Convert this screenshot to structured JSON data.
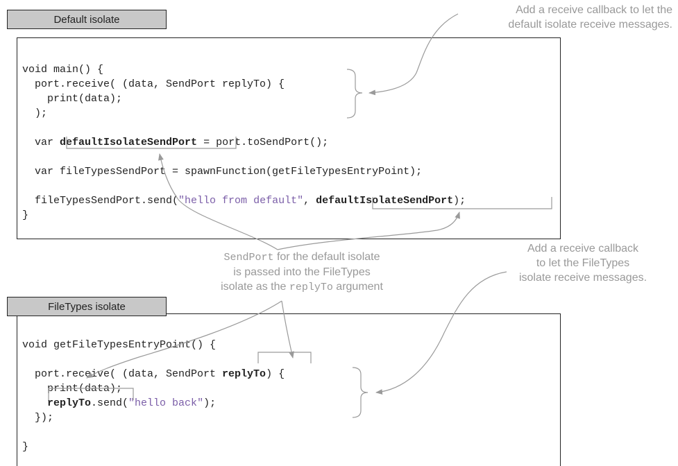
{
  "default_box": {
    "title": "Default isolate",
    "lines": [
      [
        "void main() {"
      ],
      [
        "  port.receive( (data, SendPort replyTo) {"
      ],
      [
        "    print(data);"
      ],
      [
        "  );"
      ],
      [
        ""
      ],
      [
        "  var ",
        {
          "b": "defaultIsolateSendPort"
        },
        " = port.toSendPort();"
      ],
      [
        ""
      ],
      [
        "  var fileTypesSendPort = spawnFunction(getFileTypesEntryPoint);"
      ],
      [
        ""
      ],
      [
        "  fileTypesSendPort.send(",
        {
          "s": "\"hello from default\""
        },
        ", ",
        {
          "b": "defaultIsolateSendPort"
        },
        ");"
      ],
      [
        "}"
      ]
    ]
  },
  "filetypes_box": {
    "title": "FileTypes isolate",
    "lines": [
      [
        "void getFileTypesEntryPoint() {"
      ],
      [
        ""
      ],
      [
        "  port.receive( (data, SendPort ",
        {
          "b": "replyTo"
        },
        ") {"
      ],
      [
        "    print(data);"
      ],
      [
        "    ",
        {
          "b": "replyTo"
        },
        ".send(",
        {
          "s": "\"hello back\""
        },
        ");"
      ],
      [
        "  });"
      ],
      [
        ""
      ],
      [
        "}"
      ]
    ]
  },
  "annotations": {
    "top_callback": [
      "Add a receive callback to let the",
      "default isolate receive messages."
    ],
    "middle_sendport": {
      "line1_mono": "SendPort",
      "line1_rest": " for the default isolate",
      "line2": "is passed into the FileTypes",
      "line3_pre": "isolate as the ",
      "line3_mono": "replyTo",
      "line3_post": " argument"
    },
    "filetypes_callback": [
      "Add a receive callback",
      "to let the FileTypes",
      "isolate receive messages."
    ]
  },
  "colors": {
    "string": "#7b5ea8",
    "annotation": "#999999",
    "arrow": "#9a9a9a"
  }
}
